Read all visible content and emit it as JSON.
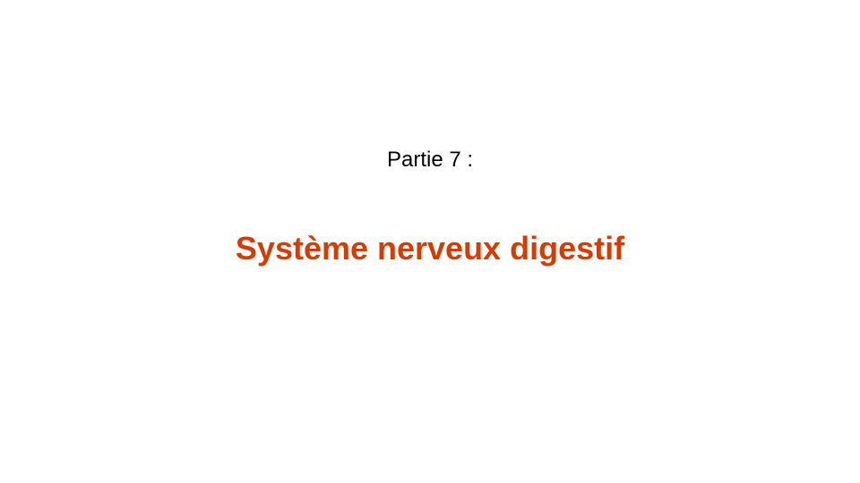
{
  "slide": {
    "part_label": "Partie 7 :",
    "title": "Système nerveux digestif",
    "title_color": "#d83b01",
    "background": "#ffffff"
  }
}
